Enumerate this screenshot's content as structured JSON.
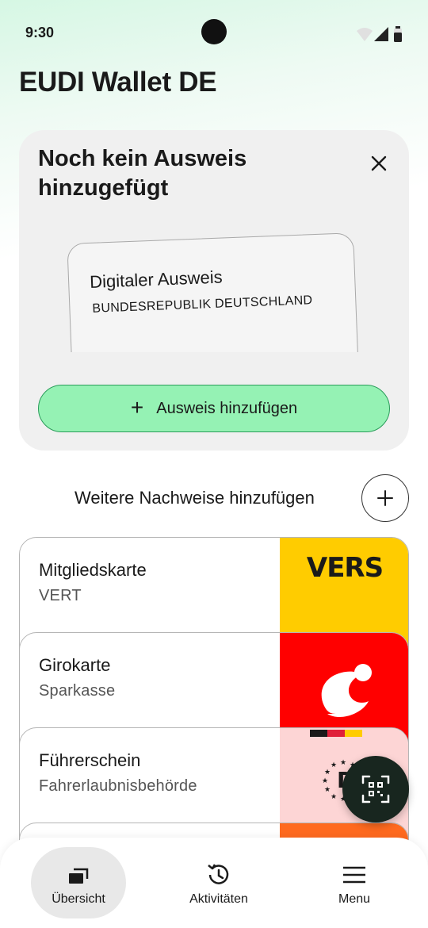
{
  "status_bar": {
    "time": "9:30",
    "icons": [
      "wifi-icon",
      "signal-icon",
      "battery-icon"
    ]
  },
  "header": {
    "title": "EUDI Wallet DE"
  },
  "id_prompt": {
    "title": "Noch kein Ausweis hinzugefügt",
    "close_icon": "close-icon",
    "mock_card": {
      "title": "Digitaler Ausweis",
      "subtitle": "BUNDESREPUBLIK DEUTSCHLAND"
    },
    "add_button_label": "Ausweis hinzufügen",
    "add_icon": "plus-icon"
  },
  "more_credentials": {
    "label": "Weitere Nachweise hinzufügen",
    "icon": "plus-circle-icon"
  },
  "cards": [
    {
      "title": "Mitgliedskarte",
      "subtitle": "VERT",
      "art_text": "VERS",
      "art_color": "#ffcc00"
    },
    {
      "title": "Girokarte",
      "subtitle": "Sparkasse",
      "art_color": "#ff0000"
    },
    {
      "title": "Führerschein",
      "subtitle": "Fahrerlaubnisbehörde",
      "art_color": "#fdd5d5"
    },
    {
      "title": "",
      "subtitle": "",
      "art_color": "#ff6a1f"
    }
  ],
  "scan_fab": {
    "icon": "qr-scan-icon"
  },
  "bottom_nav": {
    "items": [
      {
        "label": "Übersicht",
        "icon": "cards-stack-icon",
        "active": true
      },
      {
        "label": "Aktivitäten",
        "icon": "history-icon",
        "active": false
      },
      {
        "label": "Menu",
        "icon": "hamburger-menu-icon",
        "active": false
      }
    ]
  },
  "colors": {
    "accent_green": "#95f2b4",
    "fab_dark": "#18261f",
    "card_background": "#f0f0f0"
  }
}
